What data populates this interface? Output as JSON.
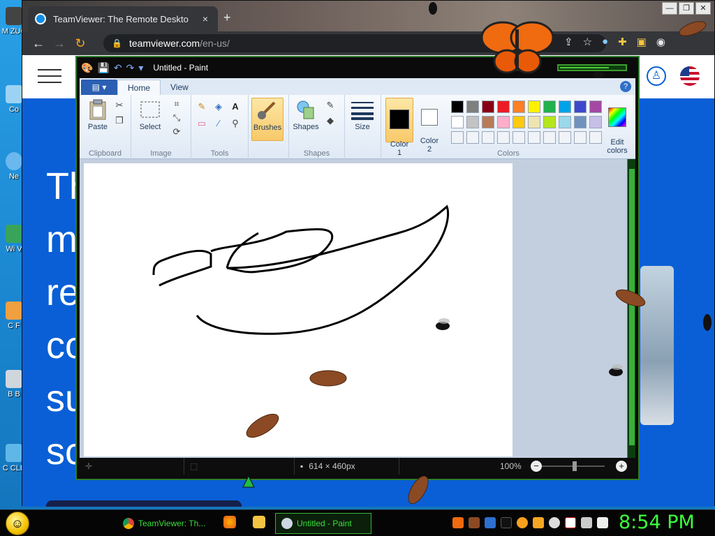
{
  "desktop": {
    "icons": [
      "M ZUC",
      "Co",
      "Ne",
      "Wi V",
      "C F",
      "B B",
      "C CLE"
    ]
  },
  "browser": {
    "tab_title": "TeamViewer: The Remote Deskto",
    "tab_close": "×",
    "new_tab": "+",
    "window_controls": [
      "—",
      "❐",
      "✕"
    ],
    "url_host": "teamviewer.com",
    "url_path": "/en-us/"
  },
  "website": {
    "hero_lines": [
      "Th",
      "m",
      "re",
      "co",
      "su",
      "sc"
    ]
  },
  "paint": {
    "title": "Untitled - Paint",
    "file_menu": "▤ ▾",
    "tabs": [
      "Home",
      "View"
    ],
    "help": "?",
    "groups": {
      "clipboard": "Clipboard",
      "image": "Image",
      "tools": "Tools",
      "shapes": "Shapes",
      "colors": "Colors"
    },
    "buttons": {
      "paste": "Paste",
      "select": "Select",
      "brushes": "Brushes",
      "shapes": "Shapes",
      "size": "Size",
      "color1": "Color\n1",
      "color2": "Color\n2",
      "edit_colors": "Edit\ncolors"
    },
    "palette_row1": [
      "#000000",
      "#7f7f7f",
      "#880015",
      "#ed1c24",
      "#ff7f27",
      "#fff200",
      "#22b14c",
      "#00a2e8",
      "#3f48cc",
      "#a349a4"
    ],
    "palette_row2": [
      "#ffffff",
      "#c3c3c3",
      "#b97a57",
      "#ffaec9",
      "#ffc90e",
      "#efe4b0",
      "#b5e61d",
      "#99d9ea",
      "#7092be",
      "#c8bfe7"
    ],
    "status": {
      "dimensions": "614 × 460px",
      "zoom": "100%"
    }
  },
  "taskbar": {
    "items": [
      "TeamViewer: Th...",
      "Untitled - Paint"
    ],
    "clock": "8:54 PM"
  }
}
